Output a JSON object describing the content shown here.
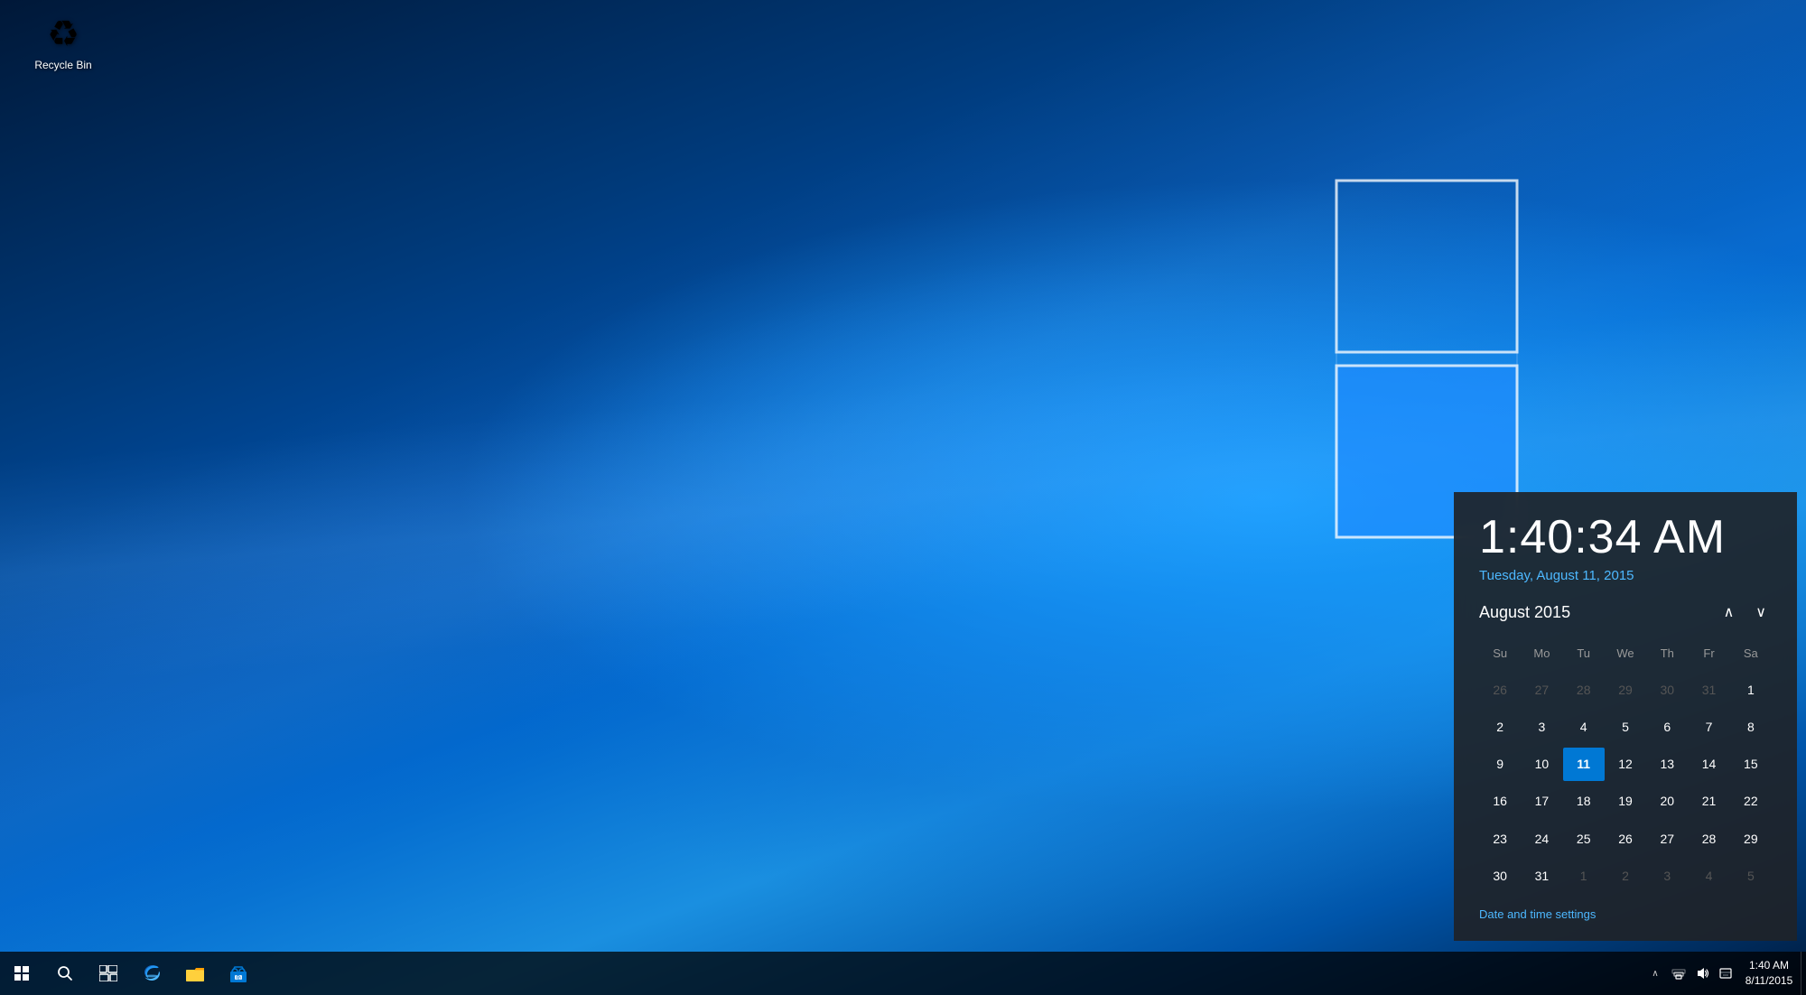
{
  "desktop": {
    "background_color": "#001838"
  },
  "recycle_bin": {
    "label": "Recycle Bin",
    "icon": "🗑"
  },
  "clock_flyout": {
    "time": "1:40:34 AM",
    "date": "Tuesday, August 11, 2015",
    "calendar": {
      "month_year": "August 2015",
      "nav_prev_label": "∧",
      "nav_next_label": "∨",
      "day_headers": [
        "Su",
        "Mo",
        "Tu",
        "We",
        "Th",
        "Fr",
        "Sa"
      ],
      "weeks": [
        [
          {
            "day": "26",
            "type": "other"
          },
          {
            "day": "27",
            "type": "other"
          },
          {
            "day": "28",
            "type": "other"
          },
          {
            "day": "29",
            "type": "other"
          },
          {
            "day": "30",
            "type": "other"
          },
          {
            "day": "31",
            "type": "other"
          },
          {
            "day": "1",
            "type": "normal"
          }
        ],
        [
          {
            "day": "2",
            "type": "normal"
          },
          {
            "day": "3",
            "type": "normal"
          },
          {
            "day": "4",
            "type": "normal"
          },
          {
            "day": "5",
            "type": "normal"
          },
          {
            "day": "6",
            "type": "normal"
          },
          {
            "day": "7",
            "type": "normal"
          },
          {
            "day": "8",
            "type": "normal"
          }
        ],
        [
          {
            "day": "9",
            "type": "normal"
          },
          {
            "day": "10",
            "type": "normal"
          },
          {
            "day": "11",
            "type": "today"
          },
          {
            "day": "12",
            "type": "normal"
          },
          {
            "day": "13",
            "type": "normal"
          },
          {
            "day": "14",
            "type": "normal"
          },
          {
            "day": "15",
            "type": "normal"
          }
        ],
        [
          {
            "day": "16",
            "type": "normal"
          },
          {
            "day": "17",
            "type": "normal"
          },
          {
            "day": "18",
            "type": "normal"
          },
          {
            "day": "19",
            "type": "normal"
          },
          {
            "day": "20",
            "type": "normal"
          },
          {
            "day": "21",
            "type": "normal"
          },
          {
            "day": "22",
            "type": "normal"
          }
        ],
        [
          {
            "day": "23",
            "type": "normal"
          },
          {
            "day": "24",
            "type": "normal"
          },
          {
            "day": "25",
            "type": "normal"
          },
          {
            "day": "26",
            "type": "normal"
          },
          {
            "day": "27",
            "type": "normal"
          },
          {
            "day": "28",
            "type": "normal"
          },
          {
            "day": "29",
            "type": "normal"
          }
        ],
        [
          {
            "day": "30",
            "type": "normal"
          },
          {
            "day": "31",
            "type": "normal"
          },
          {
            "day": "1",
            "type": "other"
          },
          {
            "day": "2",
            "type": "other"
          },
          {
            "day": "3",
            "type": "other"
          },
          {
            "day": "4",
            "type": "other"
          },
          {
            "day": "5",
            "type": "other"
          }
        ]
      ],
      "settings_link": "Date and time settings"
    }
  },
  "taskbar": {
    "start_label": "Start",
    "search_label": "Search",
    "task_view_label": "Task View",
    "apps": [
      {
        "name": "Edge",
        "icon": "e"
      },
      {
        "name": "File Explorer",
        "icon": "📁"
      },
      {
        "name": "Store",
        "icon": "🛍"
      }
    ],
    "tray": {
      "chevron": "∧",
      "network_icon": "network",
      "volume_icon": "volume",
      "notification_icon": "notification",
      "time": "1:40 AM",
      "date": "8/11/2015"
    }
  }
}
